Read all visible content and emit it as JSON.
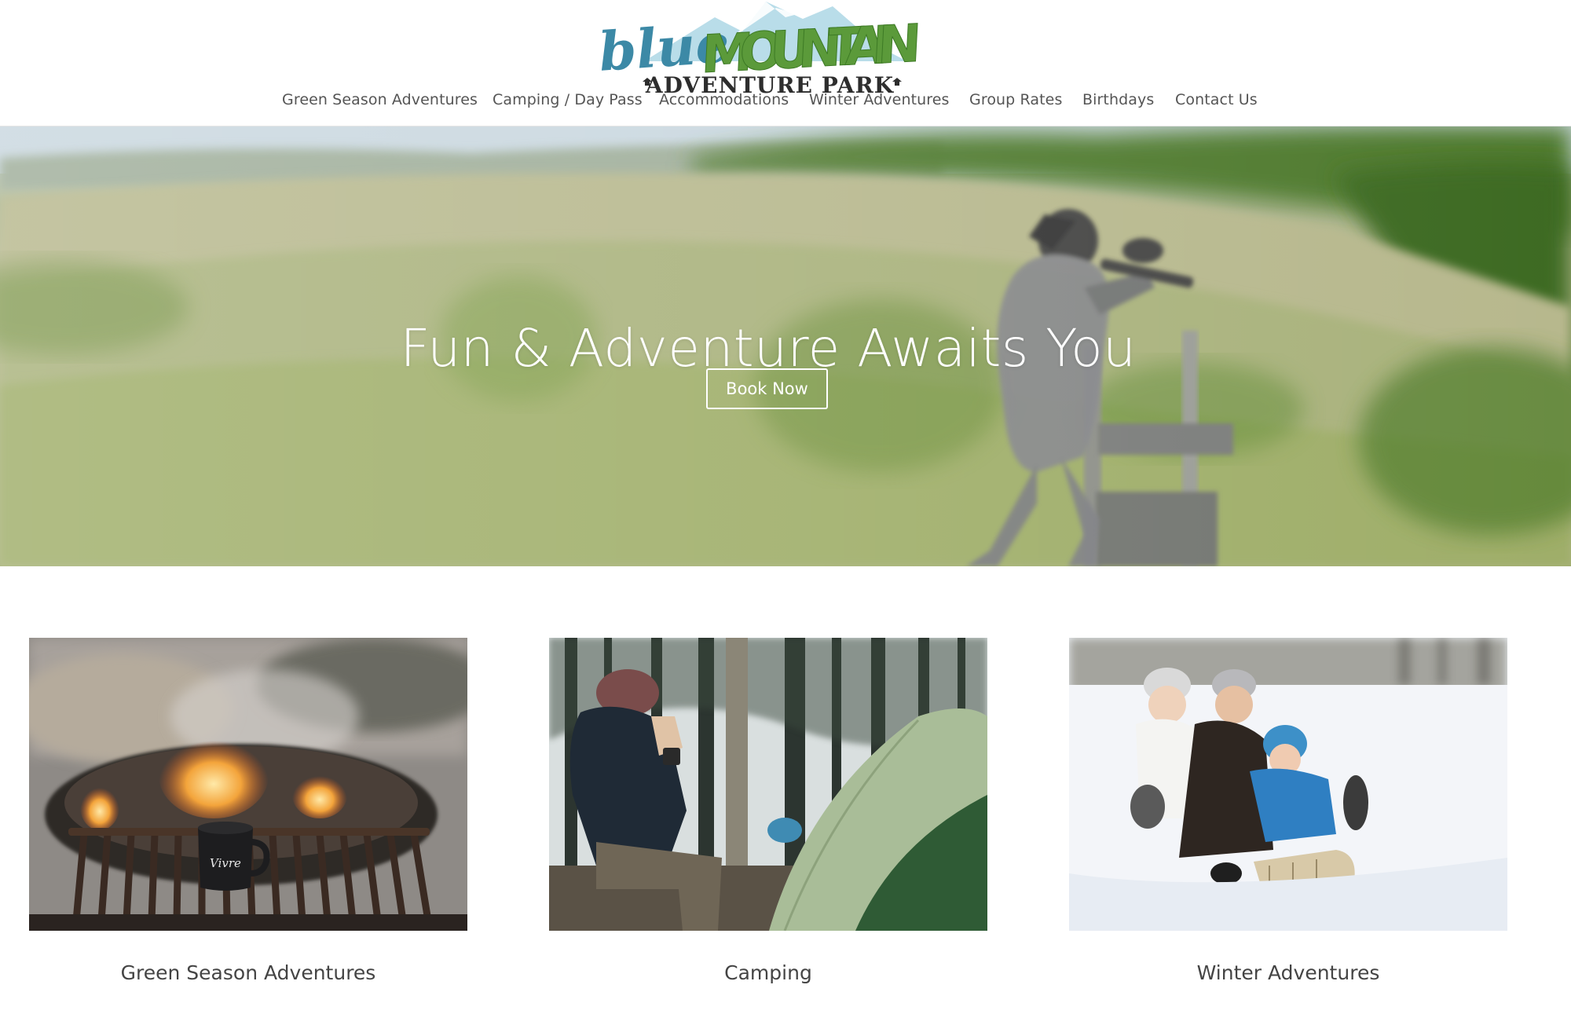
{
  "logo": {
    "word_blue": "blue",
    "word_mountain": "MOUNTAIN",
    "tagline": "ADVENTURE PARK",
    "colors": {
      "blue": "#3c89a6",
      "green": "#5b9a3a",
      "dark": "#2d2d2d"
    }
  },
  "nav": {
    "items": [
      {
        "label": "Green Season Adventures"
      },
      {
        "label": "Camping / Day Pass"
      },
      {
        "label": "Accommodations"
      },
      {
        "label": "Winter Adventures"
      },
      {
        "label": "Group Rates"
      },
      {
        "label": "Birthdays"
      },
      {
        "label": "Contact Us"
      }
    ]
  },
  "hero": {
    "title": "Fun & Adventure Awaits You",
    "button_label": "Book Now"
  },
  "cards": [
    {
      "label": "Green Season Adventures",
      "image": "campfire-grill-mug"
    },
    {
      "label": "Camping",
      "image": "camper-beside-tent"
    },
    {
      "label": "Winter Adventures",
      "image": "family-tobogganing"
    }
  ],
  "mug_text": "Vivre"
}
